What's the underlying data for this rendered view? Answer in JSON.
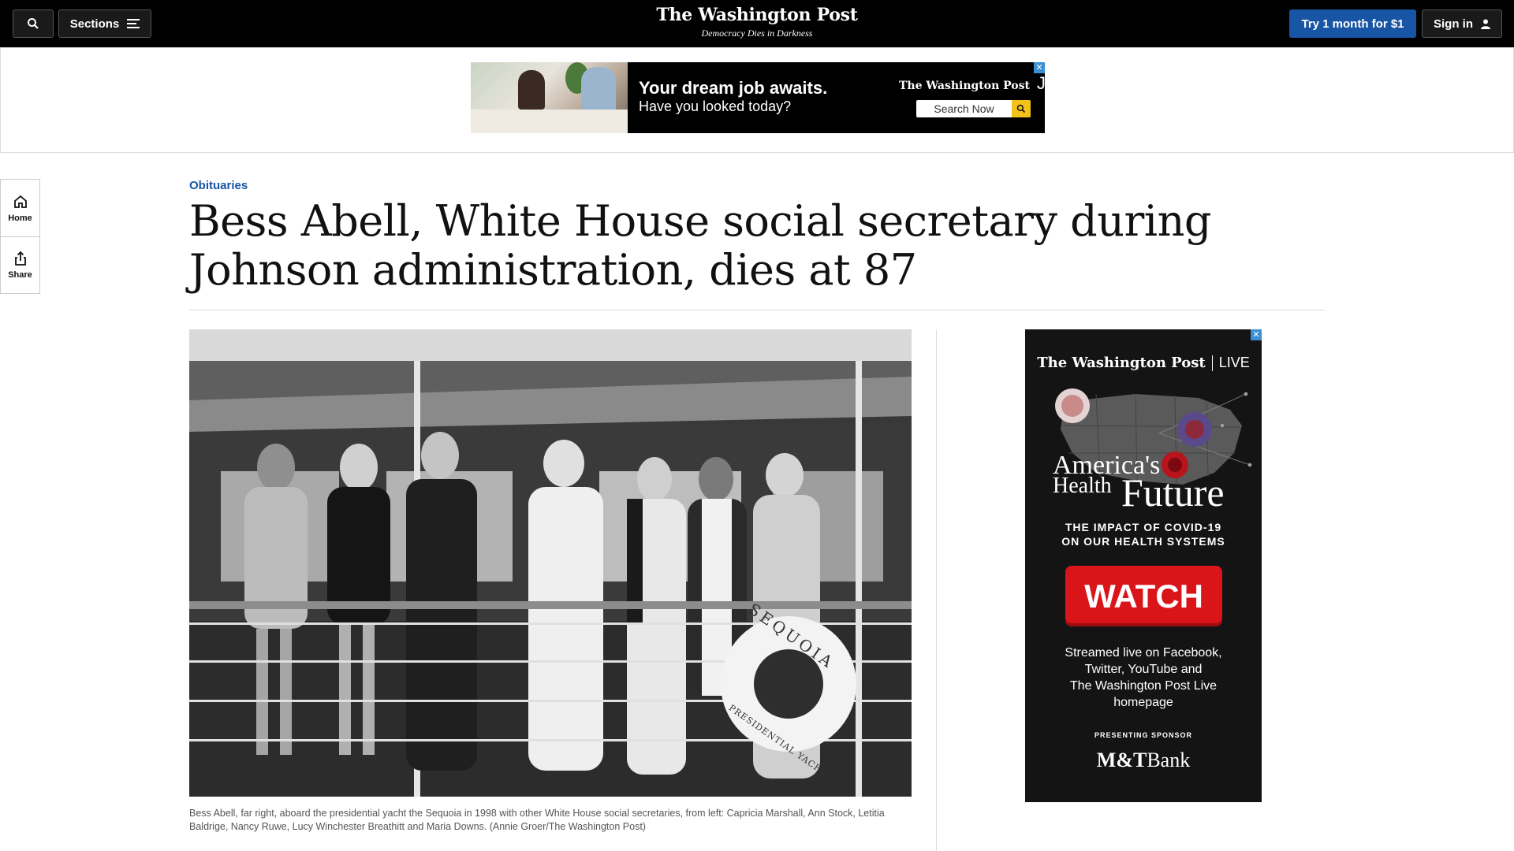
{
  "topbar": {
    "sections_label": "Sections",
    "logo": "The Washington Post",
    "tagline": "Democracy Dies in Darkness",
    "try_label": "Try 1 month for $1",
    "signin_label": "Sign in"
  },
  "top_ad": {
    "headline": "Your dream job awaits.",
    "subline": "Have you looked today?",
    "brand": "The Washington Post",
    "brand_suffix": "Jobs",
    "search_label": "Search Now",
    "close": "✕"
  },
  "rail": {
    "items": [
      {
        "label": "Home",
        "icon": "home-icon"
      },
      {
        "label": "Share",
        "icon": "share-icon"
      }
    ]
  },
  "article": {
    "kicker": "Obituaries",
    "headline": "Bess Abell, White House social secretary during Johnson administration, dies at 87",
    "photo_ring_text_top": "SEQUOIA",
    "photo_ring_text_bottom": "PRESIDENTIAL YACHT",
    "caption": "Bess Abell, far right, aboard the presidential yacht the Sequoia in 1998 with other White House social secretaries, from left: Capricia Marshall, Ann Stock, Letitia Baldrige, Nancy Ruwe, Lucy Winchester Breathitt and Maria Downs. (Annie Groer/The Washington Post)"
  },
  "side_ad": {
    "brand": "The Washington Post",
    "brand_suffix": "LIVE",
    "title_line1": "America's",
    "title_line2": "Health",
    "title_line3": "Future",
    "subtitle_line1": "THE IMPACT OF COVID-19",
    "subtitle_line2": "ON OUR HEALTH SYSTEMS",
    "watch_label": "WATCH",
    "desc_line1": "Streamed live on Facebook,",
    "desc_line2": "Twitter, YouTube and",
    "desc_line3": "The Washington Post Live",
    "desc_line4": "homepage",
    "presenting": "PRESENTING SPONSOR",
    "sponsor_part1": "M&T",
    "sponsor_part2": "Bank",
    "close": "✕"
  },
  "colors": {
    "accent_blue": "#1955a5",
    "watch_red": "#d9151a",
    "ad_close_blue": "#3b8fd4"
  }
}
